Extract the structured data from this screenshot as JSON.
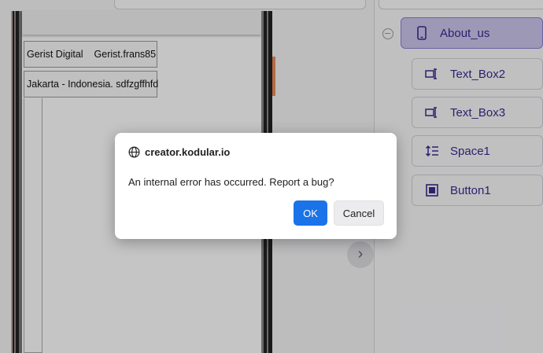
{
  "designer": {
    "labels": [
      {
        "left": "Gerist Digital",
        "right": "Gerist.frans85"
      },
      {
        "text": "Jakarta - Indonesia. sdfzgffhfd"
      }
    ]
  },
  "components": {
    "items": [
      {
        "label": "About_us",
        "icon": "phone-icon",
        "selected": true
      },
      {
        "label": "Text_Box2",
        "icon": "textbox-icon"
      },
      {
        "label": "Text_Box3",
        "icon": "textbox-icon"
      },
      {
        "label": "Space1",
        "icon": "space-icon"
      },
      {
        "label": "Button1",
        "icon": "button-icon"
      }
    ]
  },
  "dialog": {
    "origin": "creator.kodular.io",
    "message": "An internal error has occurred. Report a bug?",
    "ok_label": "OK",
    "cancel_label": "Cancel"
  },
  "colors": {
    "accent": "#1a73e8",
    "component_text": "#3b2a8c",
    "selected_bg": "#c9c3ea"
  }
}
